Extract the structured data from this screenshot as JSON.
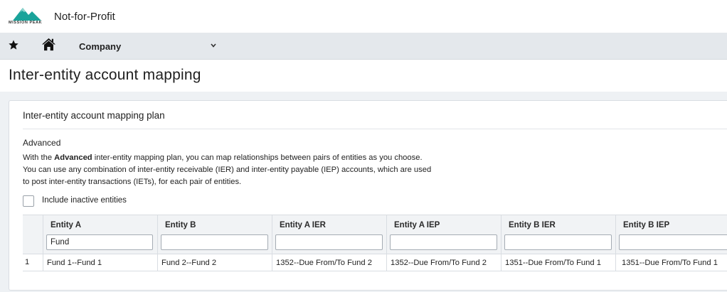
{
  "brand": {
    "logo_text": "MISSION PEAK",
    "company_name": "Not-for-Profit",
    "accent_color": "#1aa39a"
  },
  "nav": {
    "star_icon": "star-icon",
    "home_icon": "home-icon",
    "menu_label": "Company",
    "menu_chevron": "chevron-down-icon"
  },
  "page": {
    "title": "Inter-entity account mapping"
  },
  "panel": {
    "title": "Inter-entity account mapping plan",
    "plan_heading": "Advanced",
    "description_prefix": "With the ",
    "description_bold": "Advanced",
    "description_rest": " inter-entity mapping plan, you can map relationships between pairs of entities as you choose. You can use any combination of inter-entity receivable (IER) and inter-entity payable (IEP) accounts, which are used to post inter-entity transactions (IETs), for each pair of entities.",
    "include_inactive_label": "Include inactive entities",
    "include_inactive_checked": false
  },
  "grid": {
    "columns": [
      {
        "label": "Entity A",
        "filter": "Fund"
      },
      {
        "label": "Entity B",
        "filter": ""
      },
      {
        "label": "Entity A IER",
        "filter": ""
      },
      {
        "label": "Entity A IEP",
        "filter": ""
      },
      {
        "label": "Entity B IER",
        "filter": ""
      },
      {
        "label": "Entity B IEP",
        "filter": ""
      }
    ],
    "rows": [
      {
        "num": "1",
        "cells": [
          "Fund 1--Fund 1",
          "Fund 2--Fund 2",
          "1352--Due From/To Fund 2",
          "1352--Due From/To Fund 2",
          "1351--Due From/To Fund 1",
          "1351--Due From/To Fund 1"
        ]
      }
    ]
  }
}
